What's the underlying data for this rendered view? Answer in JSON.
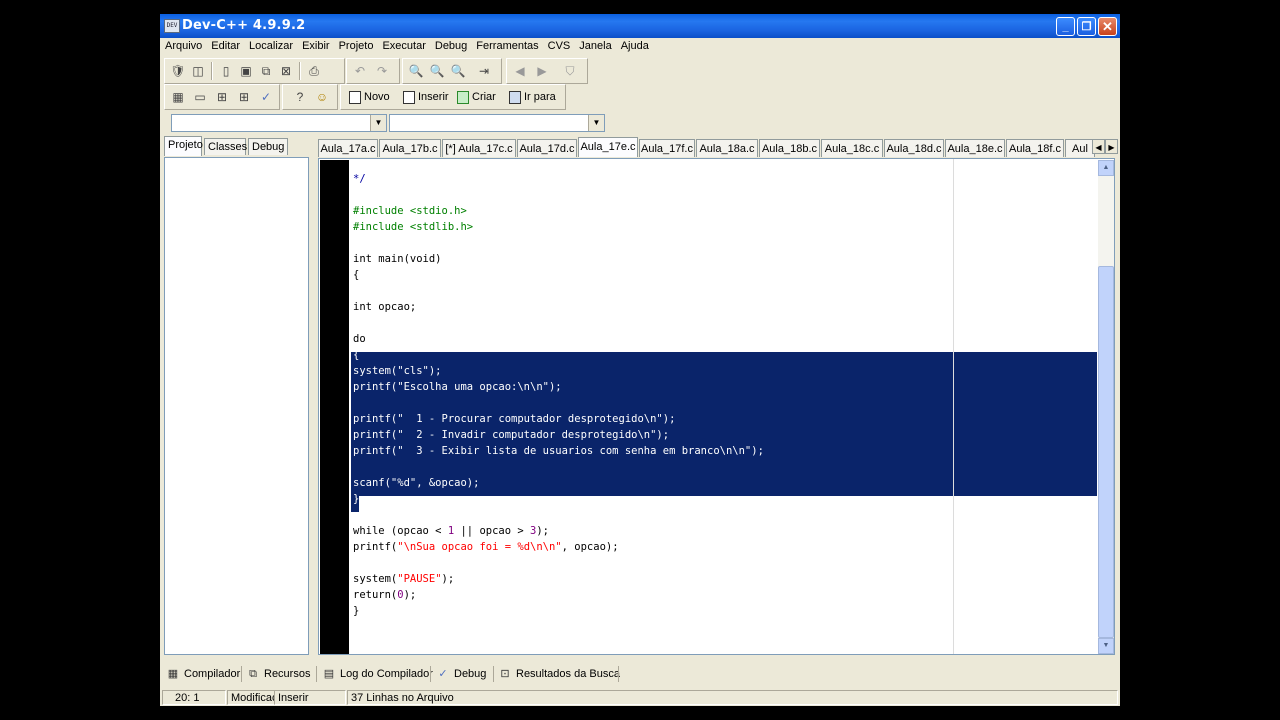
{
  "window": {
    "title": "Dev-C++ 4.9.9.2",
    "app_icon": "DEV"
  },
  "menu": [
    "Arquivo",
    "Editar",
    "Localizar",
    "Exibir",
    "Projeto",
    "Executar",
    "Debug",
    "Ferramentas",
    "CVS",
    "Janela",
    "Ajuda"
  ],
  "toolbar2": {
    "novo": "Novo",
    "inserir": "Inserir",
    "criar": "Criar",
    "ir_para": "Ir para"
  },
  "left_tabs": [
    "Projeto",
    "Classes",
    "Debug"
  ],
  "editor_tabs": [
    "Aula_17a.c",
    "Aula_17b.c",
    "[*] Aula_17c.c",
    "Aula_17d.c",
    "Aula_17e.c",
    "Aula_17f.c",
    "Aula_18a.c",
    "Aula_18b.c",
    "Aula_18c.c",
    "Aula_18d.c",
    "Aula_18e.c",
    "Aula_18f.c",
    "Aul"
  ],
  "active_tab": "Aula_17e.c",
  "code": [
    {
      "t": "*/",
      "c": "comment"
    },
    {
      "t": "",
      "c": ""
    },
    {
      "t": "#include <stdio.h>",
      "c": "pre"
    },
    {
      "t": "#include <stdlib.h>",
      "c": "pre"
    },
    {
      "t": "",
      "c": ""
    },
    {
      "t": "int main(void)",
      "c": ""
    },
    {
      "t": "{",
      "c": ""
    },
    {
      "t": "",
      "c": ""
    },
    {
      "t": "int opcao;",
      "c": ""
    },
    {
      "t": "",
      "c": ""
    },
    {
      "t": "do",
      "c": ""
    },
    {
      "t": "{",
      "c": "sel"
    },
    {
      "t": "system(\"cls\");",
      "c": "sel"
    },
    {
      "t": "printf(\"Escolha uma opcao:\\n\\n\");",
      "c": "sel"
    },
    {
      "t": "",
      "c": "sel"
    },
    {
      "t": "printf(\"  1 - Procurar computador desprotegido\\n\");",
      "c": "sel"
    },
    {
      "t": "printf(\"  2 - Invadir computador desprotegido\\n\");",
      "c": "sel"
    },
    {
      "t": "printf(\"  3 - Exibir lista de usuarios com senha em branco\\n\\n\");",
      "c": "sel"
    },
    {
      "t": "",
      "c": "sel"
    },
    {
      "t": "scanf(\"%d\", &opcao);",
      "c": "sel"
    },
    {
      "t": "}",
      "c": "cur"
    },
    {
      "t": "",
      "c": ""
    },
    {
      "t": "while (opcao < 1 || opcao > 3);",
      "c": "while"
    },
    {
      "t": "printf(\"\\nSua opcao foi = %d\\n\\n\", opcao);",
      "c": "printf2"
    },
    {
      "t": "",
      "c": ""
    },
    {
      "t": "system(\"PAUSE\");",
      "c": "system2"
    },
    {
      "t": "return(0);",
      "c": "return"
    },
    {
      "t": "}",
      "c": ""
    }
  ],
  "bottom_tabs": [
    {
      "label": "Compilador",
      "icon": "grid-icon"
    },
    {
      "label": "Recursos",
      "icon": "resources-icon"
    },
    {
      "label": "Log do Compilador",
      "icon": "log-icon"
    },
    {
      "label": "Debug",
      "icon": "check-icon"
    },
    {
      "label": "Resultados da Busca",
      "icon": "search-results-icon"
    }
  ],
  "status": {
    "position": "20: 1",
    "modified": "Modificac",
    "mode": "Inserir",
    "lines": "37 Linhas no Arquivo"
  },
  "colors": {
    "title_bar": "#0a5fe0",
    "selection": "#0a246a",
    "preprocessor": "#008000",
    "comment": "#0000a0",
    "string": "#ff0000",
    "number": "#800080"
  }
}
